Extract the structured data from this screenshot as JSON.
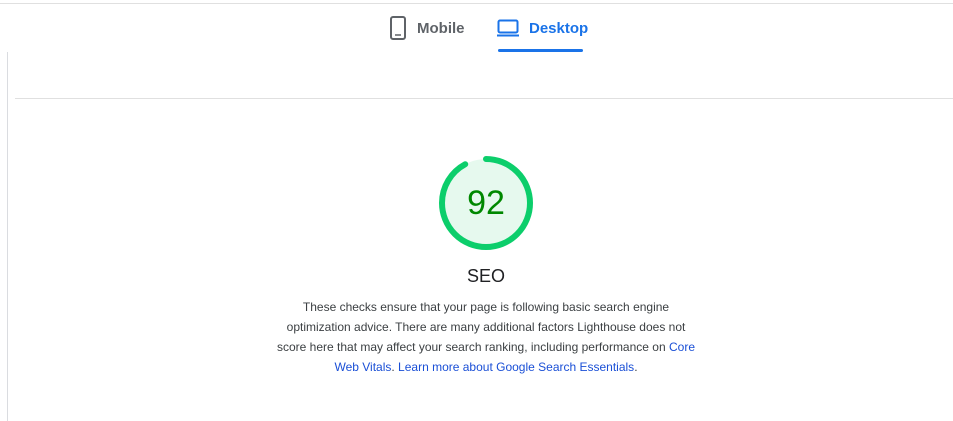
{
  "tabs": [
    {
      "label": "Mobile",
      "icon": "phone-icon",
      "active": false
    },
    {
      "label": "Desktop",
      "icon": "desktop-icon",
      "active": true
    }
  ],
  "category": {
    "score": "92",
    "score_fraction": 0.92,
    "title": "SEO",
    "colors": {
      "ring": "#0cce6b",
      "fill": "#e6f9ee",
      "text": "#008800"
    },
    "description": {
      "text": "These checks ensure that your page is following basic search engine optimization advice. There are many additional factors Lighthouse does not score here that may affect your search ranking, including performance on ",
      "link1": "Core Web Vitals",
      "between": ". ",
      "link2": "Learn more about Google Search Essentials",
      "end": "."
    }
  },
  "colors": {
    "accent": "#1a73e8",
    "link": "#1a4fd6"
  }
}
